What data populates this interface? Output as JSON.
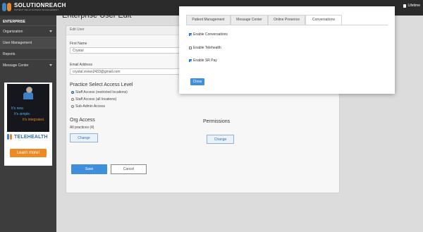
{
  "brand": {
    "name": "SOLUTIONREACH",
    "tagline": "PATIENT RELATIONSHIP MANAGEMENT",
    "colors": {
      "mark_left": "#3d86c6",
      "mark_right": "#e2892d",
      "accent": "#3f8fdc"
    }
  },
  "header": {
    "user_label": "Lifetime"
  },
  "sidebar": {
    "heading": "ENTERPRISE",
    "items": [
      {
        "label": "Organization",
        "has_chevron": true
      },
      {
        "label": "User Management",
        "has_chevron": false
      },
      {
        "label": "Reports",
        "has_chevron": false
      },
      {
        "label": "Message Center",
        "has_chevron": true
      }
    ]
  },
  "promo": {
    "line1": "It's new.",
    "line2": "It's simple.",
    "line3": "It's integrated.",
    "product": "TELEHEALTH",
    "cta": "Learn more!"
  },
  "page": {
    "title": "Enterprise User Edit",
    "panel_title": "Edit User",
    "first_name_label": "First Name",
    "first_name_value": "Crystal",
    "email_label": "Email Address",
    "email_value": "crystal.vivian2433@gmail.com",
    "access_title": "Practice Select Access Level",
    "access_options": [
      {
        "label": "Staff Access (restricted locations)",
        "selected": true
      },
      {
        "label": "Staff Access (all locations)",
        "selected": false
      },
      {
        "label": "Sub-Admin Access",
        "selected": false
      }
    ],
    "org_access_title": "Org Access",
    "org_access_value": "All practices (4)",
    "org_change": "Change",
    "permissions_title": "Permissions",
    "permissions_change": "Change",
    "save": "Save",
    "cancel": "Cancel"
  },
  "modal": {
    "tabs": [
      {
        "label": "Patient Management",
        "active": false
      },
      {
        "label": "Message Center",
        "active": false
      },
      {
        "label": "Online Presence",
        "active": false
      },
      {
        "label": "Conversations",
        "active": true
      }
    ],
    "options": [
      {
        "label": "Enable Conversations",
        "checked": true
      },
      {
        "label": "Enable Telehealth",
        "checked": false
      },
      {
        "label": "Enable SR Pay",
        "checked": true
      }
    ],
    "close": "Close"
  }
}
